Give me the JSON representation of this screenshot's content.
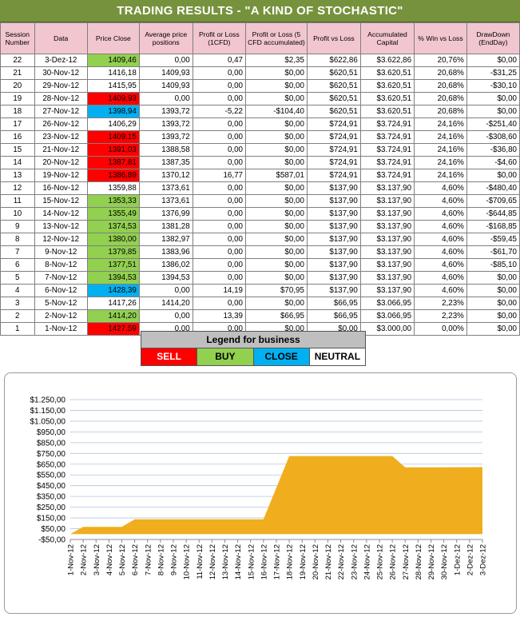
{
  "title": "TRADING RESULTS - \"A KIND OF STOCHASTIC\"",
  "table": {
    "headers": [
      "Session Number",
      "Data",
      "Price Close",
      "Average price positions",
      "Profit or Loss (1CFD)",
      "Profit or Loss (5 CFD accumulated)",
      "Profit vs Loss",
      "Accumulated Capital",
      "% Win vs Loss",
      "DrawDown (EndDay)"
    ],
    "rows": [
      {
        "session": "22",
        "date": "3-Dez-12",
        "price": "1409,46",
        "signal": "buy",
        "avg": "0,00",
        "pl1": "0,47",
        "pl5": "$2,35",
        "pvl": "$622,86",
        "capital": "$3.622,86",
        "win": "20,76%",
        "dd": "$0,00"
      },
      {
        "session": "21",
        "date": "30-Nov-12",
        "price": "1416,18",
        "signal": "neutral",
        "avg": "1409,93",
        "pl1": "0,00",
        "pl5": "$0,00",
        "pvl": "$620,51",
        "capital": "$3.620,51",
        "win": "20,68%",
        "dd": "-$31,25"
      },
      {
        "session": "20",
        "date": "29-Nov-12",
        "price": "1415,95",
        "signal": "neutral",
        "avg": "1409,93",
        "pl1": "0,00",
        "pl5": "$0,00",
        "pvl": "$620,51",
        "capital": "$3.620,51",
        "win": "20,68%",
        "dd": "-$30,10"
      },
      {
        "session": "19",
        "date": "28-Nov-12",
        "price": "1409,93",
        "signal": "sell",
        "avg": "0,00",
        "pl1": "0,00",
        "pl5": "$0,00",
        "pvl": "$620,51",
        "capital": "$3.620,51",
        "win": "20,68%",
        "dd": "$0,00"
      },
      {
        "session": "18",
        "date": "27-Nov-12",
        "price": "1398,94",
        "signal": "close",
        "avg": "1393,72",
        "pl1": "-5,22",
        "pl5": "-$104,40",
        "pvl": "$620,51",
        "capital": "$3.620,51",
        "win": "20,68%",
        "dd": "$0,00"
      },
      {
        "session": "17",
        "date": "26-Nov-12",
        "price": "1406,29",
        "signal": "neutral",
        "avg": "1393,72",
        "pl1": "0,00",
        "pl5": "$0,00",
        "pvl": "$724,91",
        "capital": "$3.724,91",
        "win": "24,16%",
        "dd": "-$251,40"
      },
      {
        "session": "16",
        "date": "23-Nov-12",
        "price": "1409,15",
        "signal": "sell",
        "avg": "1393,72",
        "pl1": "0,00",
        "pl5": "$0,00",
        "pvl": "$724,91",
        "capital": "$3.724,91",
        "win": "24,16%",
        "dd": "-$308,60"
      },
      {
        "session": "15",
        "date": "21-Nov-12",
        "price": "1391,03",
        "signal": "sell",
        "avg": "1388,58",
        "pl1": "0,00",
        "pl5": "$0,00",
        "pvl": "$724,91",
        "capital": "$3.724,91",
        "win": "24,16%",
        "dd": "-$36,80"
      },
      {
        "session": "14",
        "date": "20-Nov-12",
        "price": "1387,81",
        "signal": "sell",
        "avg": "1387,35",
        "pl1": "0,00",
        "pl5": "$0,00",
        "pvl": "$724,91",
        "capital": "$3.724,91",
        "win": "24,16%",
        "dd": "-$4,60"
      },
      {
        "session": "13",
        "date": "19-Nov-12",
        "price": "1386,89",
        "signal": "sell",
        "avg": "1370,12",
        "pl1": "16,77",
        "pl5": "$587,01",
        "pvl": "$724,91",
        "capital": "$3.724,91",
        "win": "24,16%",
        "dd": "$0,00"
      },
      {
        "session": "12",
        "date": "16-Nov-12",
        "price": "1359,88",
        "signal": "neutral",
        "avg": "1373,61",
        "pl1": "0,00",
        "pl5": "$0,00",
        "pvl": "$137,90",
        "capital": "$3.137,90",
        "win": "4,60%",
        "dd": "-$480,40"
      },
      {
        "session": "11",
        "date": "15-Nov-12",
        "price": "1353,33",
        "signal": "buy",
        "avg": "1373,61",
        "pl1": "0,00",
        "pl5": "$0,00",
        "pvl": "$137,90",
        "capital": "$3.137,90",
        "win": "4,60%",
        "dd": "-$709,65"
      },
      {
        "session": "10",
        "date": "14-Nov-12",
        "price": "1355,49",
        "signal": "buy",
        "avg": "1376,99",
        "pl1": "0,00",
        "pl5": "$0,00",
        "pvl": "$137,90",
        "capital": "$3.137,90",
        "win": "4,60%",
        "dd": "-$644,85"
      },
      {
        "session": "9",
        "date": "13-Nov-12",
        "price": "1374,53",
        "signal": "buy",
        "avg": "1381,28",
        "pl1": "0,00",
        "pl5": "$0,00",
        "pvl": "$137,90",
        "capital": "$3.137,90",
        "win": "4,60%",
        "dd": "-$168,85"
      },
      {
        "session": "8",
        "date": "12-Nov-12",
        "price": "1380,00",
        "signal": "buy",
        "avg": "1382,97",
        "pl1": "0,00",
        "pl5": "$0,00",
        "pvl": "$137,90",
        "capital": "$3.137,90",
        "win": "4,60%",
        "dd": "-$59,45"
      },
      {
        "session": "7",
        "date": "9-Nov-12",
        "price": "1379,85",
        "signal": "buy",
        "avg": "1383,96",
        "pl1": "0,00",
        "pl5": "$0,00",
        "pvl": "$137,90",
        "capital": "$3.137,90",
        "win": "4,60%",
        "dd": "-$61,70"
      },
      {
        "session": "6",
        "date": "8-Nov-12",
        "price": "1377,51",
        "signal": "buy",
        "avg": "1386,02",
        "pl1": "0,00",
        "pl5": "$0,00",
        "pvl": "$137,90",
        "capital": "$3.137,90",
        "win": "4,60%",
        "dd": "-$85,10"
      },
      {
        "session": "5",
        "date": "7-Nov-12",
        "price": "1394,53",
        "signal": "buy",
        "avg": "1394,53",
        "pl1": "0,00",
        "pl5": "$0,00",
        "pvl": "$137,90",
        "capital": "$3.137,90",
        "win": "4,60%",
        "dd": "$0,00"
      },
      {
        "session": "4",
        "date": "6-Nov-12",
        "price": "1428,39",
        "signal": "close",
        "avg": "0,00",
        "pl1": "14,19",
        "pl5": "$70,95",
        "pvl": "$137,90",
        "capital": "$3.137,90",
        "win": "4,60%",
        "dd": "$0,00"
      },
      {
        "session": "3",
        "date": "5-Nov-12",
        "price": "1417,26",
        "signal": "neutral",
        "avg": "1414,20",
        "pl1": "0,00",
        "pl5": "$0,00",
        "pvl": "$66,95",
        "capital": "$3.066,95",
        "win": "2,23%",
        "dd": "$0,00"
      },
      {
        "session": "2",
        "date": "2-Nov-12",
        "price": "1414,20",
        "signal": "buy",
        "avg": "0,00",
        "pl1": "13,39",
        "pl5": "$66,95",
        "pvl": "$66,95",
        "capital": "$3.066,95",
        "win": "2,23%",
        "dd": "$0,00"
      },
      {
        "session": "1",
        "date": "1-Nov-12",
        "price": "1427,59",
        "signal": "sell",
        "avg": "0,00",
        "pl1": "0,00",
        "pl5": "$0,00",
        "pvl": "$0,00",
        "capital": "$3.000,00",
        "win": "0,00%",
        "dd": "$0,00"
      }
    ]
  },
  "legend": {
    "title": "Legend for business",
    "items": [
      {
        "label": "SELL",
        "color": "#ff0000"
      },
      {
        "label": "BUY",
        "color": "#92d050"
      },
      {
        "label": "CLOSE",
        "color": "#00b0f0"
      },
      {
        "label": "NEUTRAL",
        "color": "#ffffff"
      }
    ]
  },
  "colors": {
    "sell": "#ff0000",
    "buy": "#92d050",
    "close": "#00b0f0",
    "area_fill": "#f0ad1e",
    "header_green": "#76923c",
    "header_pink": "#f2c6cf"
  },
  "chart_data": {
    "type": "area",
    "title": "",
    "xlabel": "",
    "ylabel": "",
    "grid": true,
    "ylim": [
      -50,
      1250
    ],
    "yticks": [
      -50,
      50,
      150,
      250,
      350,
      450,
      550,
      650,
      750,
      850,
      950,
      1050,
      1150,
      1250
    ],
    "ytick_labels": [
      "-$50,00",
      "$50,00",
      "$150,00",
      "$250,00",
      "$350,00",
      "$450,00",
      "$550,00",
      "$650,00",
      "$750,00",
      "$850,00",
      "$950,00",
      "$1.050,00",
      "$1.150,00",
      "$1.250,00"
    ],
    "categories": [
      "1-Nov-12",
      "2-Nov-12",
      "3-Nov-12",
      "4-Nov-12",
      "5-Nov-12",
      "6-Nov-12",
      "7-Nov-12",
      "8-Nov-12",
      "9-Nov-12",
      "10-Nov-12",
      "11-Nov-12",
      "12-Nov-12",
      "13-Nov-12",
      "14-Nov-12",
      "15-Nov-12",
      "16-Nov-12",
      "17-Nov-12",
      "18-Nov-12",
      "19-Nov-12",
      "20-Nov-12",
      "21-Nov-12",
      "22-Nov-12",
      "23-Nov-12",
      "24-Nov-12",
      "25-Nov-12",
      "26-Nov-12",
      "27-Nov-12",
      "28-Nov-12",
      "29-Nov-12",
      "30-Nov-12",
      "1-Dez-12",
      "2-Dez-12",
      "3-Dez-12"
    ],
    "values": [
      0,
      66.95,
      66.95,
      66.95,
      66.95,
      137.9,
      137.9,
      137.9,
      137.9,
      137.9,
      137.9,
      137.9,
      137.9,
      137.9,
      137.9,
      137.9,
      431.4,
      724.91,
      724.91,
      724.91,
      724.91,
      724.91,
      724.91,
      724.91,
      724.91,
      724.91,
      620.51,
      620.51,
      620.51,
      620.51,
      621.7,
      621.7,
      622.86
    ]
  }
}
